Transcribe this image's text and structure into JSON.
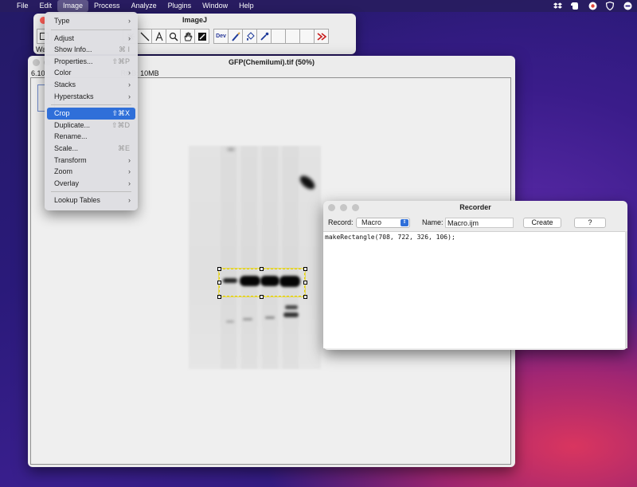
{
  "menubar": {
    "items": [
      "File",
      "Edit",
      "Image",
      "Process",
      "Analyze",
      "Plugins",
      "Window",
      "Help"
    ],
    "active_index": 2,
    "status_icons": [
      "dropbox-icon",
      "evernote-icon",
      "chrome-icon",
      "shield-icon",
      "user-badge-icon"
    ]
  },
  "imagej": {
    "title": "ImageJ",
    "status_text": "Wa",
    "dev_label": "Dev"
  },
  "image_window": {
    "title": "GFP(Chemilumi).tif (50%)",
    "info_prefix": "6.10",
    "info_suffix": "RGB; 10MB"
  },
  "image_menu": {
    "items": [
      {
        "label": "Type",
        "submenu": true
      },
      {
        "sep": true
      },
      {
        "label": "Adjust",
        "submenu": true
      },
      {
        "label": "Show Info...",
        "shortcut": "⌘ I"
      },
      {
        "label": "Properties...",
        "shortcut": "⇧⌘P"
      },
      {
        "label": "Color",
        "submenu": true
      },
      {
        "label": "Stacks",
        "submenu": true
      },
      {
        "label": "Hyperstacks",
        "submenu": true
      },
      {
        "sep": true
      },
      {
        "label": "Crop",
        "shortcut": "⇧⌘X",
        "highlighted": true
      },
      {
        "label": "Duplicate...",
        "shortcut": "⇧⌘D"
      },
      {
        "label": "Rename..."
      },
      {
        "label": "Scale...",
        "shortcut": "⌘E"
      },
      {
        "label": "Transform",
        "submenu": true
      },
      {
        "label": "Zoom",
        "submenu": true
      },
      {
        "label": "Overlay",
        "submenu": true
      },
      {
        "sep": true
      },
      {
        "label": "Lookup Tables",
        "submenu": true
      }
    ]
  },
  "recorder": {
    "title": "Recorder",
    "record_label": "Record:",
    "record_value": "Macro",
    "name_label": "Name:",
    "name_value": "Macro.ijm",
    "create_label": "Create",
    "help_label": "?",
    "text": "makeRectangle(708, 722, 326, 106);"
  },
  "colors": {
    "accent": "#2f6fd9",
    "roi": "#e6d200",
    "close_red": "#ff5f57"
  }
}
